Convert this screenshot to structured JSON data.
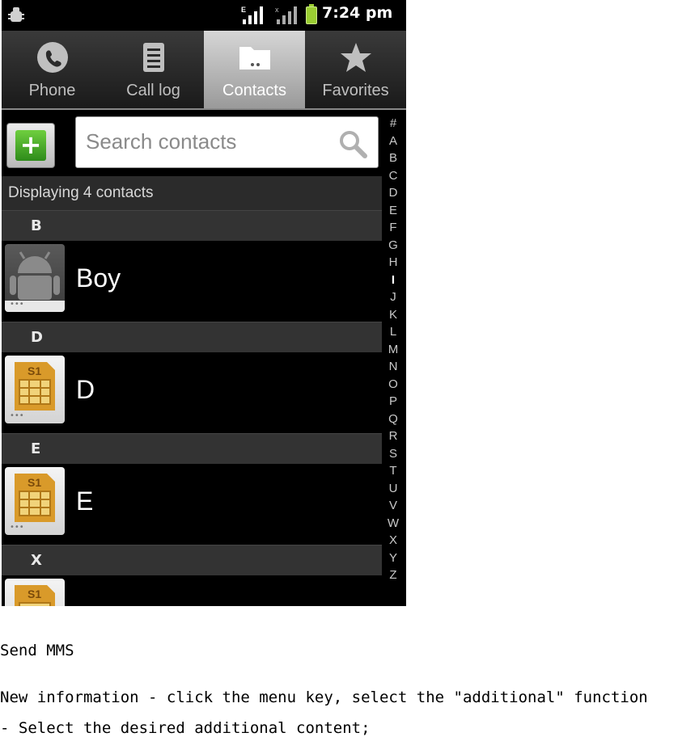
{
  "status_bar": {
    "time": "7:24 pm",
    "icons": [
      "debug-icon",
      "signal-e-icon",
      "signal-no-data-icon",
      "battery-charging-icon"
    ],
    "signal_1_type": "E"
  },
  "tabs": [
    {
      "label": "Phone",
      "icon": "phone-icon",
      "active": false
    },
    {
      "label": "Call log",
      "icon": "call-log-icon",
      "active": false
    },
    {
      "label": "Contacts",
      "icon": "contacts-folder-icon",
      "active": true
    },
    {
      "label": "Favorites",
      "icon": "star-icon",
      "active": false
    }
  ],
  "search": {
    "placeholder": "Search contacts"
  },
  "contacts": {
    "count_text": "Displaying 4 contacts",
    "sections": [
      {
        "letter": "B",
        "items": [
          {
            "name": "Boy",
            "photo": "android-avatar-icon"
          }
        ]
      },
      {
        "letter": "D",
        "items": [
          {
            "name": "D",
            "photo": "sim-card-icon",
            "sim_label": "S1"
          }
        ]
      },
      {
        "letter": "E",
        "items": [
          {
            "name": "E",
            "photo": "sim-card-icon",
            "sim_label": "S1"
          }
        ]
      },
      {
        "letter": "X",
        "items": [
          {
            "name": "",
            "photo": "sim-card-icon",
            "sim_label": "S1"
          }
        ]
      }
    ]
  },
  "alpha_index": [
    "#",
    "A",
    "B",
    "C",
    "D",
    "E",
    "F",
    "G",
    "H",
    "I",
    "J",
    "K",
    "L",
    "M",
    "N",
    "O",
    "P",
    "Q",
    "R",
    "S",
    "T",
    "U",
    "V",
    "W",
    "X",
    "Y",
    "Z"
  ],
  "caption": {
    "title": "Send MMS",
    "line1": "New information - click the menu key, select the \"additional\" function",
    "line2": "- Select the desired additional content;"
  },
  "colors": {
    "active_tab": "#bdbdbd",
    "add_button_green": "#3aa020",
    "section_header": "#333333"
  }
}
